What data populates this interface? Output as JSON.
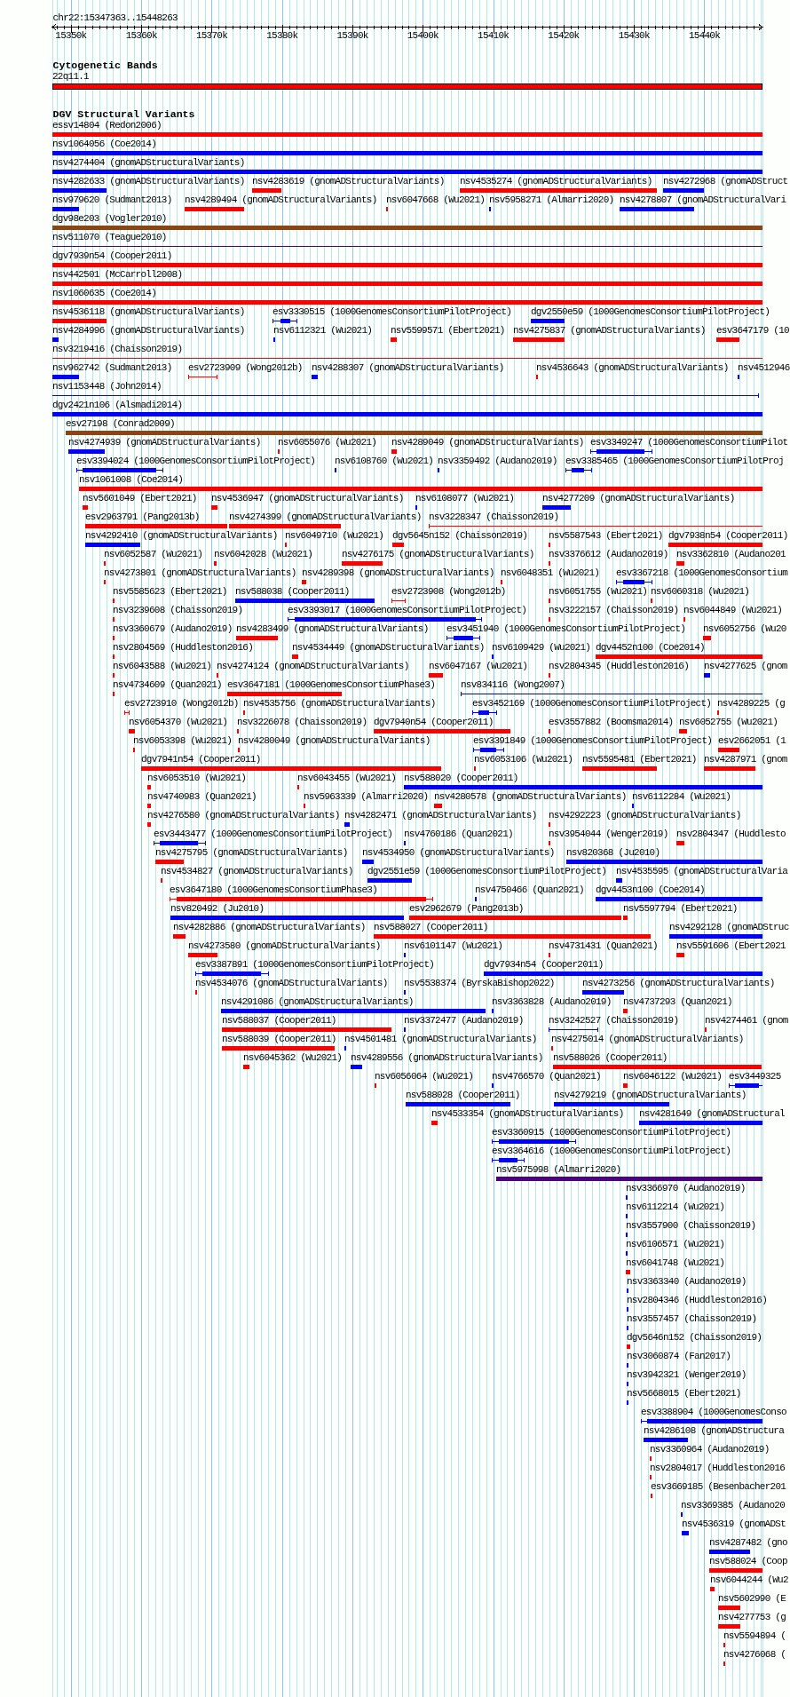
{
  "ruler": {
    "location": "chr22:15347363..15448263",
    "ticks": [
      "15350k",
      "15360k",
      "15370k",
      "15380k",
      "15390k",
      "15400k",
      "15410k",
      "15420k",
      "15430k",
      "15440k"
    ]
  },
  "tracks": [
    {
      "kind": "cytoband",
      "title": "Cytogenetic Bands",
      "rows": [
        [
          {
            "label": "22q11.1"
          }
        ]
      ]
    },
    {
      "kind": "variants",
      "title": "DGV Structural Variants",
      "rows": [
        [
          {
            "label": "essv14804 (Redon2006)",
            "color": "#ff0000",
            "kind": "bar"
          }
        ],
        [
          {
            "label": "nsv1064056 (Coe2014)",
            "color": "#0000ff",
            "kind": "bar"
          }
        ],
        [
          {
            "label": "nsv4274404 (gnomADStructuralVariants)",
            "color": "#0000ff",
            "kind": "bar"
          }
        ],
        [
          {
            "label": "nsv4282633 (gnomADStructuralVariants)",
            "color": "#0000ff",
            "kind": "bar"
          },
          {
            "label": "nsv4283619 (gnomADStructuralVariants)",
            "color": "#ff0000",
            "kind": "bar"
          },
          {
            "label": "nsv4535274 (gnomADStructuralVariants)",
            "color": "#ff0000",
            "kind": "bar"
          },
          {
            "label": "nsv4272968 (gnomADStruct",
            "color": "#0000ff",
            "kind": "bar"
          }
        ],
        [
          {
            "label": "nsv979620 (Sudmant2013)",
            "color": "#0000ff",
            "kind": "bar"
          },
          {
            "label": "nsv4289494 (gnomADStructuralVariants)",
            "color": "#ff0000",
            "kind": "bar"
          },
          {
            "label": "nsv6047668 (Wu2021)",
            "color": "#ff0000",
            "kind": "bar"
          },
          {
            "label": "nsv5958271 (Almarri2020)",
            "color": "#0000ff",
            "kind": "bar"
          },
          {
            "label": "nsv4278807 (gnomADStructuralVari",
            "color": "#0000ff",
            "kind": "bar"
          }
        ],
        [
          {
            "label": "dgv98e203 (Vogler2010)",
            "color": "#8b4513",
            "kind": "bar"
          }
        ],
        [
          {
            "label": "nsv511070 (Teague2010)",
            "color": "#4b0082",
            "kind": "line"
          }
        ],
        [
          {
            "label": "dgv7939n54 (Cooper2011)",
            "color": "#ff0000",
            "kind": "bar"
          }
        ],
        [
          {
            "label": "nsv442501 (McCarroll2008)",
            "color": "#ff0000",
            "kind": "bar"
          }
        ],
        [
          {
            "label": "nsv1060635 (Coe2014)",
            "color": "#ff0000",
            "kind": "bar"
          }
        ],
        [
          {
            "label": "nsv4536118 (gnomADStructuralVariants)",
            "color": "#ff0000",
            "kind": "bar"
          },
          {
            "label": "esv3330515 (1000GenomesConsortiumPilotProject)",
            "color": "#0000ff",
            "kind": "interval"
          },
          {
            "label": "dgv2550e59 (1000GenomesConsortiumPilotProject)",
            "color": "#0000ff",
            "kind": "bar"
          }
        ],
        [
          {
            "label": "nsv4284996 (gnomADStructuralVariants)",
            "color": "#0000ff",
            "kind": "bar"
          },
          {
            "label": "nsv6112321 (Wu2021)",
            "color": "#0000ff",
            "kind": "bar"
          },
          {
            "label": "nsv5599571 (Ebert2021)",
            "color": "#ff0000",
            "kind": "bar"
          },
          {
            "label": "nsv4275837 (gnomADStructuralVariants)",
            "color": "#ff0000",
            "kind": "bar"
          },
          {
            "label": "esv3647179 (10",
            "color": "#ff0000",
            "kind": "bar"
          }
        ],
        [
          {
            "label": "nsv3219416 (Chaisson2019)",
            "color": "#ff0000",
            "kind": "line"
          }
        ],
        [
          {
            "label": "nsv962742 (Sudmant2013)",
            "color": "#0000ff",
            "kind": "bar"
          },
          {
            "label": "esv2723909 (Wong2012b)",
            "color": "#ff0000",
            "kind": "line"
          },
          {
            "label": "nsv4288307 (gnomADStructuralVariants)",
            "color": "#0000ff",
            "kind": "bar"
          },
          {
            "label": "nsv4536643 (gnomADStructuralVariants)",
            "color": "#ff0000",
            "kind": "bar"
          },
          {
            "label": "nsv4512946",
            "color": "#0000ff",
            "kind": "bar"
          }
        ],
        [
          {
            "label": "nsv1153448 (John2014)",
            "color": "#0000ff",
            "kind": "line"
          }
        ],
        [
          {
            "label": "dgv2421n106 (Alsmadi2014)",
            "color": "#0000ff",
            "kind": "bar"
          }
        ],
        [
          {
            "label": "esv27198 (Conrad2009)",
            "color": "#8b4513",
            "kind": "bar"
          }
        ],
        [
          {
            "label": "nsv4274939 (gnomADStructuralVariants)",
            "color": "#0000ff",
            "kind": "bar"
          },
          {
            "label": "nsv6055076 (Wu2021)",
            "color": "#ff0000",
            "kind": "bar"
          },
          {
            "label": "nsv4289049 (gnomADStructuralVariants)",
            "color": "#ff0000",
            "kind": "bar"
          },
          {
            "label": "esv3349247 (1000GenomesConsortiumPilot",
            "color": "#0000ff",
            "kind": "interval"
          }
        ],
        [
          {
            "label": "esv3394024 (1000GenomesConsortiumPilotProject)",
            "color": "#0000ff",
            "kind": "interval"
          },
          {
            "label": "nsv6108760 (Wu2021)",
            "color": "#0000ff",
            "kind": "bar"
          },
          {
            "label": "nsv3359492 (Audano2019)",
            "color": "#0000ff",
            "kind": "bar"
          },
          {
            "label": "esv3385465 (1000GenomesConsortiumPilotProj",
            "color": "#0000ff",
            "kind": "interval"
          }
        ],
        [
          {
            "label": "nsv1061008 (Coe2014)",
            "color": "#ff0000",
            "kind": "bar"
          }
        ],
        [
          {
            "label": "nsv5601049 (Ebert2021)",
            "color": "#ff0000",
            "kind": "bar"
          },
          {
            "label": "nsv4536947 (gnomADStructuralVariants)",
            "color": "#ff0000",
            "kind": "bar"
          },
          {
            "label": "nsv6108077 (Wu2021)",
            "color": "#0000ff",
            "kind": "bar"
          },
          {
            "label": "nsv4277209 (gnomADStructuralVariants)",
            "color": "#0000ff",
            "kind": "bar"
          }
        ],
        [
          {
            "label": "esv2963791 (Pang2013b)",
            "color": "#ff0000",
            "kind": "bar"
          },
          {
            "label": "nsv4274399 (gnomADStructuralVariants)",
            "color": "#ff0000",
            "kind": "bar"
          },
          {
            "label": "nsv3228347 (Chaisson2019)",
            "color": "#ff0000",
            "kind": "line"
          }
        ],
        [
          {
            "label": "nsv4292410 (gnomADStructuralVariants)",
            "color": "#0000ff",
            "kind": "bar"
          },
          {
            "label": "nsv6049710 (Wu2021)",
            "color": "#ff0000",
            "kind": "bar"
          },
          {
            "label": "dgv5645n152 (Chaisson2019)",
            "color": "#ff0000",
            "kind": "bar"
          },
          {
            "label": "nsv5587543 (Ebert2021)",
            "color": "#ff0000",
            "kind": "bar"
          },
          {
            "label": "dgv7938n54 (Cooper2011)",
            "color": "#ff0000",
            "kind": "bar"
          }
        ],
        [
          {
            "label": "nsv6052587 (Wu2021)",
            "color": "#ff0000",
            "kind": "bar"
          },
          {
            "label": "nsv6042028 (Wu2021)",
            "color": "#ff0000",
            "kind": "bar"
          },
          {
            "label": "nsv4276175 (gnomADStructuralVariants)",
            "color": "#ff0000",
            "kind": "bar"
          },
          {
            "label": "nsv3376612 (Audano2019)",
            "color": "#ff0000",
            "kind": "bar"
          },
          {
            "label": "nsv3362810 (Audano201",
            "color": "#ff0000",
            "kind": "bar"
          }
        ],
        [
          {
            "label": "nsv4273801 (gnomADStructuralVariants)",
            "color": "#ff0000",
            "kind": "bar"
          },
          {
            "label": "nsv4289398 (gnomADStructuralVariants)",
            "color": "#ff0000",
            "kind": "bar"
          },
          {
            "label": "nsv6048351 (Wu2021)",
            "color": "#ff0000",
            "kind": "bar"
          },
          {
            "label": "esv3367218 (1000GenomesConsortium",
            "color": "#0000ff",
            "kind": "interval"
          }
        ],
        [
          {
            "label": "nsv5585623 (Ebert2021)",
            "color": "#ff0000",
            "kind": "bar"
          },
          {
            "label": "nsv588038 (Cooper2011)",
            "color": "#0000ff",
            "kind": "bar"
          },
          {
            "label": "esv2723908 (Wong2012b)",
            "color": "#ff0000",
            "kind": "line"
          },
          {
            "label": "nsv6051755 (Wu2021)",
            "color": "#ff0000",
            "kind": "bar"
          },
          {
            "label": "nsv6060318 (Wu2021)",
            "color": "#ff0000",
            "kind": "bar"
          }
        ],
        [
          {
            "label": "nsv3239608 (Chaisson2019)",
            "color": "#ff0000",
            "kind": "bar"
          },
          {
            "label": "esv3393017 (1000GenomesConsortiumPilotProject)",
            "color": "#0000ff",
            "kind": "interval"
          },
          {
            "label": "nsv3222157 (Chaisson2019)",
            "color": "#ff0000",
            "kind": "bar"
          },
          {
            "label": "nsv6044849 (Wu2021)",
            "color": "#ff0000",
            "kind": "bar"
          }
        ],
        [
          {
            "label": "nsv3360679 (Audano2019)",
            "color": "#ff0000",
            "kind": "bar"
          },
          {
            "label": "nsv4283499 (gnomADStructuralVariants)",
            "color": "#ff0000",
            "kind": "bar"
          },
          {
            "label": "esv3451940 (1000GenomesConsortiumPilotProject)",
            "color": "#0000ff",
            "kind": "interval"
          },
          {
            "label": "nsv6052756 (Wu20",
            "color": "#ff0000",
            "kind": "bar"
          }
        ],
        [
          {
            "label": "nsv2804569 (Huddleston2016)",
            "color": "#ff0000",
            "kind": "bar"
          },
          {
            "label": "nsv4534449 (gnomADStructuralVariants)",
            "color": "#ff0000",
            "kind": "bar"
          },
          {
            "label": "nsv6109429 (Wu2021)",
            "color": "#0000ff",
            "kind": "bar"
          },
          {
            "label": "dgv4452n100 (Coe2014)",
            "color": "#ff0000",
            "kind": "bar"
          }
        ],
        [
          {
            "label": "nsv6043588 (Wu2021)",
            "color": "#ff0000",
            "kind": "bar"
          },
          {
            "label": "nsv4274124 (gnomADStructuralVariants)",
            "color": "#ff0000",
            "kind": "bar"
          },
          {
            "label": "nsv6047167 (Wu2021)",
            "color": "#ff0000",
            "kind": "bar"
          },
          {
            "label": "nsv2804345 (Huddleston2016)",
            "color": "#ff0000",
            "kind": "bar"
          },
          {
            "label": "nsv4277625 (gnom",
            "color": "#0000ff",
            "kind": "bar"
          }
        ],
        [
          {
            "label": "nsv4734609 (Quan2021)",
            "color": "#ff0000",
            "kind": "bar"
          },
          {
            "label": "esv3647181 (1000GenomesConsortiumPhase3)",
            "color": "#ff0000",
            "kind": "bar"
          },
          {
            "label": "nsv834116 (Wong2007)",
            "color": "#0000ff",
            "kind": "line"
          }
        ],
        [
          {
            "label": "esv2723910 (Wong2012b)",
            "color": "#ff0000",
            "kind": "line"
          },
          {
            "label": "nsv4535756 (gnomADStructuralVariants)",
            "color": "#ff0000",
            "kind": "bar"
          },
          {
            "label": "esv3452169 (1000GenomesConsortiumPilotProject)",
            "color": "#0000ff",
            "kind": "interval"
          },
          {
            "label": "nsv4289225 (g",
            "color": "#ff0000",
            "kind": "bar"
          }
        ],
        [
          {
            "label": "nsv6054370 (Wu2021)",
            "color": "#ff0000",
            "kind": "bar"
          },
          {
            "label": "nsv3226078 (Chaisson2019)",
            "color": "#ff0000",
            "kind": "bar"
          },
          {
            "label": "dgv7940n54 (Cooper2011)",
            "color": "#ff0000",
            "kind": "bar"
          },
          {
            "label": "esv3557882 (Boomsma2014)",
            "color": "#ff0000",
            "kind": "bar"
          },
          {
            "label": "nsv6052755 (Wu2021)",
            "color": "#ff0000",
            "kind": "bar"
          }
        ],
        [
          {
            "label": "nsv6053398 (Wu2021)",
            "color": "#ff0000",
            "kind": "bar"
          },
          {
            "label": "nsv4280049 (gnomADStructuralVariants)",
            "color": "#ff0000",
            "kind": "bar"
          },
          {
            "label": "esv3391849 (1000GenomesConsortiumPilotProject)",
            "color": "#0000ff",
            "kind": "interval"
          },
          {
            "label": "esv2662051 (1",
            "color": "#ff0000",
            "kind": "bar"
          }
        ],
        [
          {
            "label": "dgv7941n54 (Cooper2011)",
            "color": "#ff0000",
            "kind": "bar"
          },
          {
            "label": "nsv6053106 (Wu2021)",
            "color": "#ff0000",
            "kind": "bar"
          },
          {
            "label": "nsv5595481 (Ebert2021)",
            "color": "#ff0000",
            "kind": "bar"
          },
          {
            "label": "nsv4287971 (gnom",
            "color": "#ff0000",
            "kind": "bar"
          }
        ],
        [
          {
            "label": "nsv6053510 (Wu2021)",
            "color": "#ff0000",
            "kind": "bar"
          },
          {
            "label": "nsv6043455 (Wu2021)",
            "color": "#ff0000",
            "kind": "bar"
          },
          {
            "label": "nsv588020 (Cooper2011)",
            "color": "#0000ff",
            "kind": "bar"
          }
        ],
        [
          {
            "label": "nsv4740983 (Quan2021)",
            "color": "#ff0000",
            "kind": "bar"
          },
          {
            "label": "nsv5963339 (Almarri2020)",
            "color": "#ff0000",
            "kind": "bar"
          },
          {
            "label": "nsv4280578 (gnomADStructuralVariants)",
            "color": "#ff0000",
            "kind": "bar"
          },
          {
            "label": "nsv6112284 (Wu2021)",
            "color": "#0000ff",
            "kind": "bar"
          }
        ],
        [
          {
            "label": "nsv4276580 (gnomADStructuralVariants)",
            "color": "#ff0000",
            "kind": "bar"
          },
          {
            "label": "nsv4282471 (gnomADStructuralVariants)",
            "color": "#0000ff",
            "kind": "bar"
          },
          {
            "label": "nsv4292223 (gnomADStructuralVariants)",
            "color": "#ff0000",
            "kind": "bar"
          }
        ],
        [
          {
            "label": "esv3443477 (1000GenomesConsortiumPilotProject)",
            "color": "#0000ff",
            "kind": "interval"
          },
          {
            "label": "nsv4760186 (Quan2021)",
            "color": "#0000ff",
            "kind": "bar"
          },
          {
            "label": "nsv3954044 (Wenger2019)",
            "color": "#ff0000",
            "kind": "bar"
          },
          {
            "label": "nsv2804347 (Huddlesto",
            "color": "#ff0000",
            "kind": "bar"
          }
        ],
        [
          {
            "label": "nsv4275795 (gnomADStructuralVariants)",
            "color": "#ff0000",
            "kind": "bar"
          },
          {
            "label": "nsv4534950 (gnomADStructuralVariants)",
            "color": "#0000ff",
            "kind": "bar"
          },
          {
            "label": "nsv820368 (Ju2010)",
            "color": "#0000ff",
            "kind": "bar"
          }
        ],
        [
          {
            "label": "nsv4534827 (gnomADStructuralVariants)",
            "color": "#ff0000",
            "kind": "bar"
          },
          {
            "label": "dgv2551e59 (1000GenomesConsortiumPilotProject)",
            "color": "#0000ff",
            "kind": "bar"
          },
          {
            "label": "nsv4535595 (gnomADStructuralVaria",
            "color": "#0000ff",
            "kind": "bar"
          }
        ],
        [
          {
            "label": "esv3647180 (1000GenomesConsortiumPhase3)",
            "color": "#ff0000",
            "kind": "interval"
          },
          {
            "label": "nsv4750466 (Quan2021)",
            "color": "#0000ff",
            "kind": "bar"
          },
          {
            "label": "dgv4453n100 (Coe2014)",
            "color": "#0000ff",
            "kind": "bar"
          }
        ],
        [
          {
            "label": "nsv820492 (Ju2010)",
            "color": "#0000ff",
            "kind": "bar"
          },
          {
            "label": "esv2962679 (Pang2013b)",
            "color": "#ff0000",
            "kind": "bar"
          },
          {
            "label": "nsv5597794 (Ebert2021)",
            "color": "#ff0000",
            "kind": "bar"
          }
        ],
        [
          {
            "label": "nsv4282886 (gnomADStructuralVariants)",
            "color": "#ff0000",
            "kind": "bar"
          },
          {
            "label": "nsv588027 (Cooper2011)",
            "color": "#ff0000",
            "kind": "bar"
          },
          {
            "label": "nsv4292128 (gnomADStruc",
            "color": "#0000ff",
            "kind": "bar"
          }
        ],
        [
          {
            "label": "nsv4273580 (gnomADStructuralVariants)",
            "color": "#ff0000",
            "kind": "bar"
          },
          {
            "label": "nsv6101147 (Wu2021)",
            "color": "#0000ff",
            "kind": "bar"
          },
          {
            "label": "nsv4731431 (Quan2021)",
            "color": "#ff0000",
            "kind": "bar"
          },
          {
            "label": "nsv5591606 (Ebert2021",
            "color": "#ff0000",
            "kind": "bar"
          }
        ],
        [
          {
            "label": "esv3387891 (1000GenomesConsortiumPilotProject)",
            "color": "#0000ff",
            "kind": "interval"
          },
          {
            "label": "dgv7934n54 (Cooper2011)",
            "color": "#0000ff",
            "kind": "bar"
          }
        ],
        [
          {
            "label": "nsv4534076 (gnomADStructuralVariants)",
            "color": "#ff0000",
            "kind": "bar"
          },
          {
            "label": "nsv5538374 (ByrskaBishop2022)",
            "color": "#0000ff",
            "kind": "bar"
          },
          {
            "label": "nsv4273256 (gnomADStructuralVariants)",
            "color": "#0000ff",
            "kind": "bar"
          }
        ],
        [
          {
            "label": "nsv4291086 (gnomADStructuralVariants)",
            "color": "#0000ff",
            "kind": "bar"
          },
          {
            "label": "nsv3363828 (Audano2019)",
            "color": "#0000ff",
            "kind": "bar"
          },
          {
            "label": "nsv4737293 (Quan2021)",
            "color": "#ff0000",
            "kind": "bar"
          }
        ],
        [
          {
            "label": "nsv588037 (Cooper2011)",
            "color": "#ff0000",
            "kind": "bar"
          },
          {
            "label": "nsv3372477 (Audano2019)",
            "color": "#0000ff",
            "kind": "bar"
          },
          {
            "label": "nsv3242527 (Chaisson2019)",
            "color": "#0000ff",
            "kind": "line"
          },
          {
            "label": "nsv4274461 (gnom",
            "color": "#ff0000",
            "kind": "bar"
          }
        ],
        [
          {
            "label": "nsv588039 (Cooper2011)",
            "color": "#ff0000",
            "kind": "bar"
          },
          {
            "label": "nsv4501481 (gnomADStructuralVariants)",
            "color": "#0000ff",
            "kind": "bar"
          },
          {
            "label": "nsv4275014 (gnomADStructuralVariants)",
            "color": "#ff0000",
            "kind": "bar"
          }
        ],
        [
          {
            "label": "nsv6045362 (Wu2021)",
            "color": "#ff0000",
            "kind": "bar"
          },
          {
            "label": "nsv4289556 (gnomADStructuralVariants)",
            "color": "#0000ff",
            "kind": "bar"
          },
          {
            "label": "nsv588026 (Cooper2011)",
            "color": "#ff0000",
            "kind": "bar"
          }
        ],
        [
          {
            "label": "nsv6056064 (Wu2021)",
            "color": "#ff0000",
            "kind": "bar"
          },
          {
            "label": "nsv4766570 (Quan2021)",
            "color": "#0000ff",
            "kind": "bar"
          },
          {
            "label": "nsv6046122 (Wu2021)",
            "color": "#ff0000",
            "kind": "bar"
          },
          {
            "label": "esv3449325",
            "color": "#0000ff",
            "kind": "interval"
          }
        ],
        [
          {
            "label": "nsv588028 (Cooper2011)",
            "color": "#0000ff",
            "kind": "bar"
          },
          {
            "label": "nsv4279219 (gnomADStructuralVariants)",
            "color": "#0000ff",
            "kind": "bar"
          }
        ],
        [
          {
            "label": "nsv4533354 (gnomADStructuralVariants)",
            "color": "#ff0000",
            "kind": "bar"
          },
          {
            "label": "nsv4281649 (gnomADStructural",
            "color": "#0000ff",
            "kind": "bar"
          }
        ],
        [
          {
            "label": "esv3360915 (1000GenomesConsortiumPilotProject)",
            "color": "#0000ff",
            "kind": "interval"
          }
        ],
        [
          {
            "label": "esv3364616 (1000GenomesConsortiumPilotProject)",
            "color": "#0000ff",
            "kind": "interval"
          }
        ],
        [
          {
            "label": "nsv5975998 (Almarri2020)",
            "color": "#4b0082",
            "kind": "bar"
          }
        ],
        [
          {
            "label": "nsv3366970 (Audano2019)",
            "color": "#0000ff",
            "kind": "bar"
          }
        ],
        [
          {
            "label": "nsv6112214 (Wu2021)",
            "color": "#0000ff",
            "kind": "bar"
          }
        ],
        [
          {
            "label": "nsv3557900 (Chaisson2019)",
            "color": "#0000ff",
            "kind": "bar"
          }
        ],
        [
          {
            "label": "nsv6106571 (Wu2021)",
            "color": "#0000ff",
            "kind": "bar"
          }
        ],
        [
          {
            "label": "nsv6041748 (Wu2021)",
            "color": "#ff0000",
            "kind": "bar"
          }
        ],
        [
          {
            "label": "nsv3363340 (Audano2019)",
            "color": "#0000ff",
            "kind": "bar"
          }
        ],
        [
          {
            "label": "nsv2804346 (Huddleston2016)",
            "color": "#0000ff",
            "kind": "bar"
          }
        ],
        [
          {
            "label": "nsv3557457 (Chaisson2019)",
            "color": "#0000ff",
            "kind": "bar"
          }
        ],
        [
          {
            "label": "dgv5646n152 (Chaisson2019)",
            "color": "#ff0000",
            "kind": "bar"
          }
        ],
        [
          {
            "label": "nsv3060874 (Fan2017)",
            "color": "#0000ff",
            "kind": "bar"
          }
        ],
        [
          {
            "label": "nsv3942321 (Wenger2019)",
            "color": "#0000ff",
            "kind": "bar"
          }
        ],
        [
          {
            "label": "nsv5668015 (Ebert2021)",
            "color": "#0000ff",
            "kind": "bar"
          }
        ],
        [
          {
            "label": "esv3388904 (1000GenomesConso",
            "color": "#0000ff",
            "kind": "interval"
          }
        ],
        [
          {
            "label": "nsv4286108 (gnomADStructura",
            "color": "#0000ff",
            "kind": "bar"
          }
        ],
        [
          {
            "label": "nsv3360964 (Audano2019)",
            "color": "#ff0000",
            "kind": "bar"
          }
        ],
        [
          {
            "label": "nsv2804017 (Huddleston2016",
            "color": "#ff0000",
            "kind": "bar"
          }
        ],
        [
          {
            "label": "esv3669185 (Besenbacher201",
            "color": "#ff0000",
            "kind": "bar"
          }
        ],
        [
          {
            "label": "nsv3369385 (Audano20",
            "color": "#0000ff",
            "kind": "bar"
          }
        ],
        [
          {
            "label": "nsv4536319 (gnomADSt",
            "color": "#0000ff",
            "kind": "bar"
          }
        ],
        [
          {
            "label": "nsv4287482 (gno",
            "color": "#0000ff",
            "kind": "bar"
          }
        ],
        [
          {
            "label": "nsv588024 (Coop",
            "color": "#ff0000",
            "kind": "bar"
          }
        ],
        [
          {
            "label": "nsv6044244 (Wu2",
            "color": "#ff0000",
            "kind": "bar"
          }
        ],
        [
          {
            "label": "nsv5602990 (E",
            "color": "#ff0000",
            "kind": "bar"
          }
        ],
        [
          {
            "label": "nsv4277753 (g",
            "color": "#ff0000",
            "kind": "bar"
          }
        ],
        [
          {
            "label": "nsv5594894 (",
            "color": "#ff0000",
            "kind": "bar"
          }
        ],
        [
          {
            "label": "nsv4276068 (",
            "color": "#ff0000",
            "kind": "bar"
          }
        ]
      ]
    }
  ]
}
